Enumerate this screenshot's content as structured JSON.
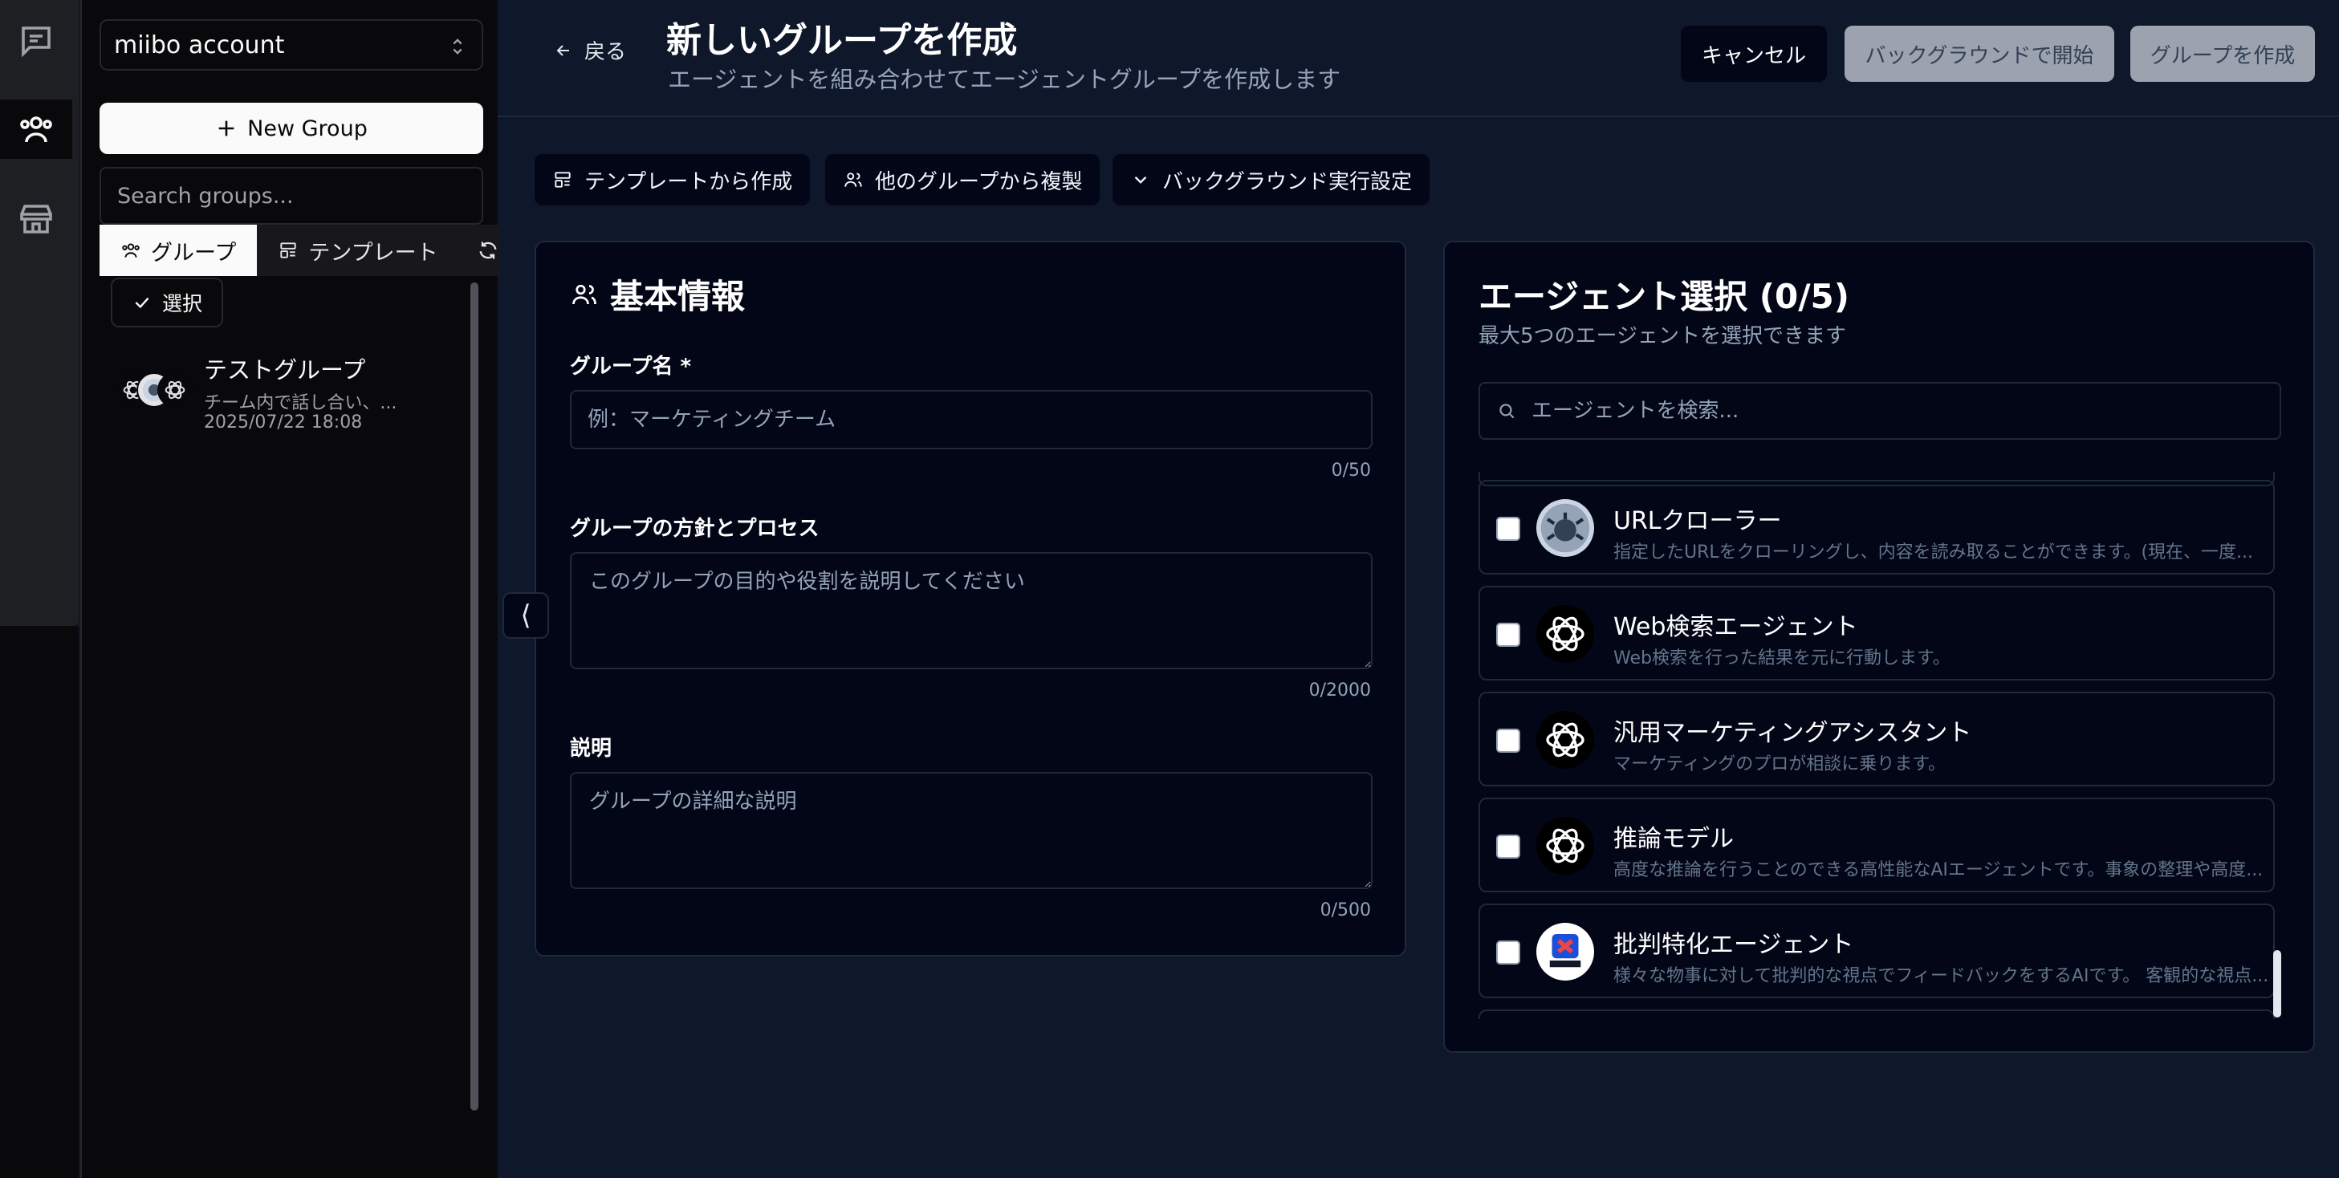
{
  "sidebar": {
    "account_name": "miibo account",
    "new_group_label": "New Group",
    "search_placeholder": "Search groups...",
    "tabs": [
      {
        "label": "グループ",
        "active": true
      },
      {
        "label": "テンプレート",
        "active": false
      }
    ],
    "select_label": "選択",
    "groups": [
      {
        "title": "テストグループ",
        "description": "チーム内で話し合い、...",
        "date": "2025/07/22 18:08"
      }
    ]
  },
  "header": {
    "back_label": "戻る",
    "title": "新しいグループを作成",
    "subtitle": "エージェントを組み合わせてエージェントグループを作成します",
    "cancel_label": "キャンセル",
    "background_start_label": "バックグラウンドで開始",
    "create_label": "グループを作成"
  },
  "actions": {
    "from_template": "テンプレートから作成",
    "duplicate_group": "他のグループから複製",
    "background_settings": "バックグラウンド実行設定"
  },
  "basic_info": {
    "title": "基本情報",
    "name_label": "グループ名 *",
    "name_placeholder": "例：マーケティングチーム",
    "name_counter": "0/50",
    "policy_label": "グループの方針とプロセス",
    "policy_placeholder": "このグループの目的や役割を説明してください",
    "policy_counter": "0/2000",
    "desc_label": "説明",
    "desc_placeholder": "グループの詳細な説明",
    "desc_counter": "0/500"
  },
  "agents": {
    "title": "エージェント選択 (0/5)",
    "subtitle": "最大5つのエージェントを選択できます",
    "search_placeholder": "エージェントを検索...",
    "items": [
      {
        "name": "URLクローラー",
        "description": "指定したURLをクローリングし、内容を読み取ることができます。(現在、一度...",
        "icon": "crawler-icon",
        "checked": false
      },
      {
        "name": "Web検索エージェント",
        "description": "Web検索を行った結果を元に行動します。",
        "icon": "openai-icon",
        "checked": false
      },
      {
        "name": "汎用マーケティングアシスタント",
        "description": "マーケティングのプロが相談に乗ります。",
        "icon": "openai-icon",
        "checked": false
      },
      {
        "name": "推論モデル",
        "description": "高度な推論を行うことのできる高性能なAIエージェントです。事象の整理や高度...",
        "icon": "openai-icon",
        "checked": false
      },
      {
        "name": "批判特化エージェント",
        "description": "様々な物事に対して批判的な視点でフィードバックをするAIです。 客観的な視点...",
        "icon": "critique-icon",
        "checked": false
      }
    ]
  },
  "colors": {
    "background": "#0f172a",
    "panel": "#020617",
    "sidebar": "#09090b",
    "disabled_button": "#9ca3af"
  }
}
